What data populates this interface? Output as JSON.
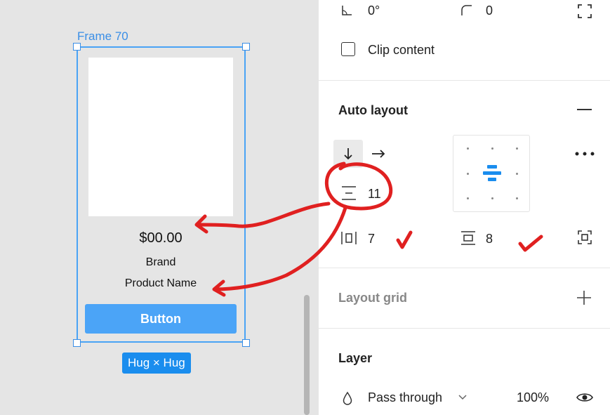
{
  "canvas": {
    "frame_label": "Frame 70",
    "price": "$00.00",
    "brand": "Brand",
    "product_name": "Product Name",
    "button_label": "Button",
    "hug_badge": "Hug × Hug"
  },
  "panel": {
    "rotation_value": "0°",
    "radius_value": "0",
    "clip_content_label": "Clip content",
    "auto_layout": {
      "title": "Auto layout",
      "spacing_value": "11",
      "horizontal_padding": "7",
      "vertical_padding": "8"
    },
    "layout_grid_title": "Layout grid",
    "layer": {
      "title": "Layer",
      "blend_mode": "Pass through",
      "opacity": "100%"
    }
  },
  "colors": {
    "selection_blue": "#3a8ee6",
    "button_blue": "#4ba4f7",
    "annotation_red": "#e02020"
  }
}
